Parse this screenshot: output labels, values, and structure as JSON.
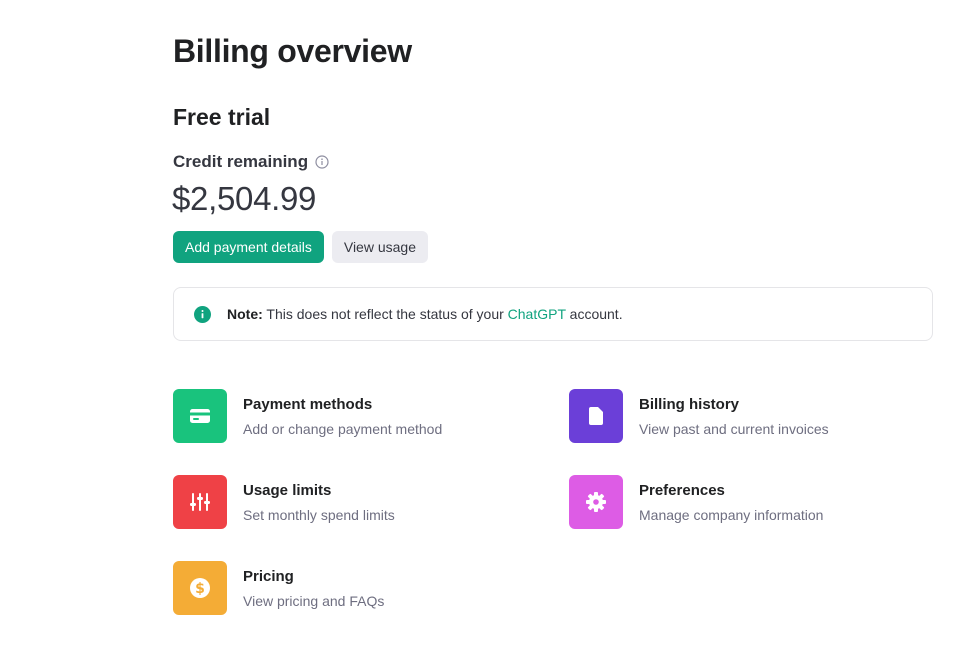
{
  "page": {
    "title": "Billing overview"
  },
  "plan": {
    "title": "Free trial"
  },
  "credit": {
    "label": "Credit remaining",
    "amount": "$2,504.99"
  },
  "actions": {
    "add_payment": "Add payment details",
    "view_usage": "View usage"
  },
  "note": {
    "label": "Note:",
    "text_before": " This does not reflect the status of your ",
    "link": "ChatGPT",
    "text_after": " account."
  },
  "cards": [
    {
      "title": "Payment methods",
      "subtitle": "Add or change payment method",
      "icon": "credit-card-icon",
      "color": "#19c37d"
    },
    {
      "title": "Billing history",
      "subtitle": "View past and current invoices",
      "icon": "document-icon",
      "color": "#6b3fd8"
    },
    {
      "title": "Usage limits",
      "subtitle": "Set monthly spend limits",
      "icon": "sliders-icon",
      "color": "#ef4146"
    },
    {
      "title": "Preferences",
      "subtitle": "Manage company information",
      "icon": "gear-icon",
      "color": "#dd5ce5"
    },
    {
      "title": "Pricing",
      "subtitle": "View pricing and FAQs",
      "icon": "dollar-coin-icon",
      "color": "#f4ac36"
    }
  ],
  "colors": {
    "accent": "#10a37f",
    "text": "#202123",
    "muted": "#6e6e80"
  }
}
